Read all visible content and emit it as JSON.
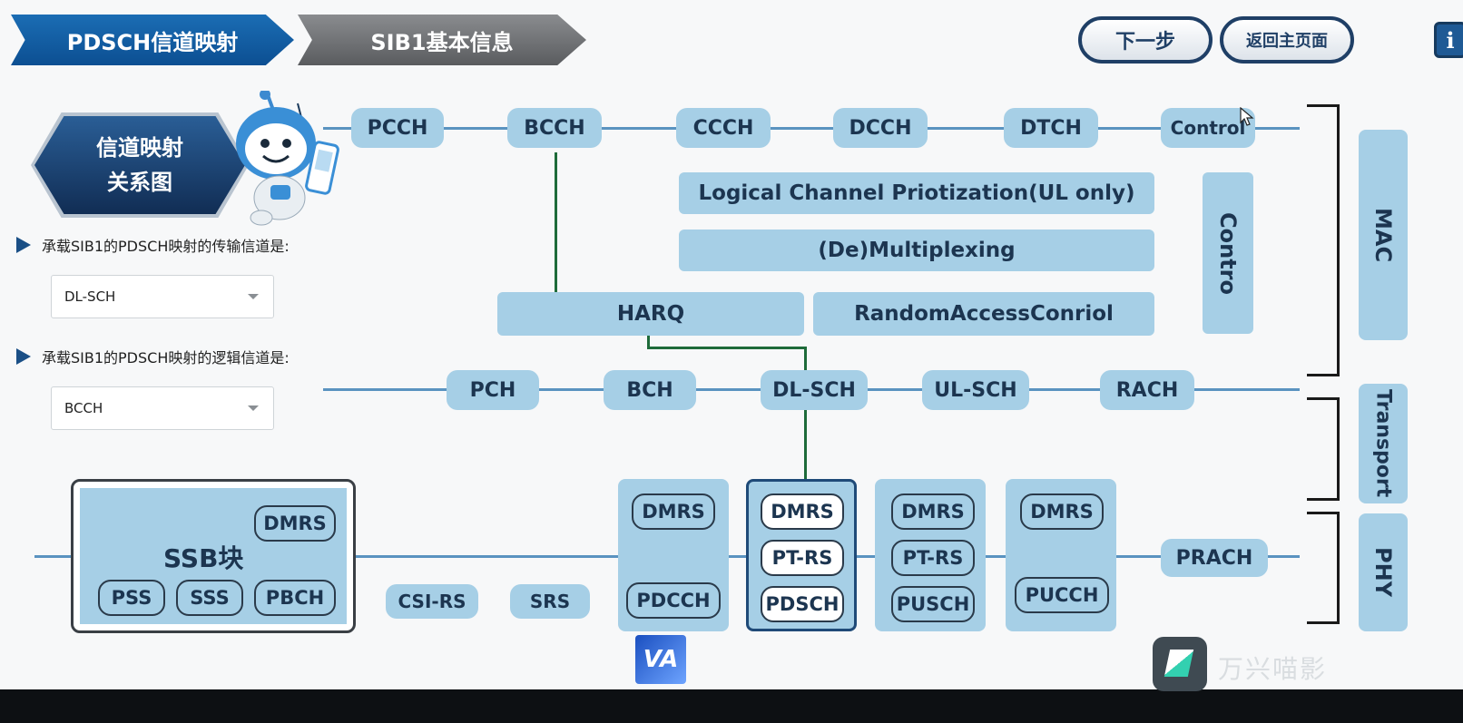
{
  "breadcrumb": {
    "active": "PDSCH信道映射",
    "next": "SIB1基本信息"
  },
  "top_buttons": {
    "next_step": "下一步",
    "home": "返回主页面",
    "info": "i"
  },
  "left_panel": {
    "title_line1": "信道映射",
    "title_line2": "关系图",
    "q1": "承载SIB1的PDSCH映射的传输信道是:",
    "q1_value": "DL-SCH",
    "q2": "承载SIB1的PDSCH映射的逻辑信道是:",
    "q2_value": "BCCH"
  },
  "logical_channels": [
    "PCCH",
    "BCCH",
    "CCCH",
    "DCCH",
    "DTCH",
    "Control"
  ],
  "mac_blocks": {
    "lcp": "Logical Channel Priotization(UL only)",
    "mux": "(De)Multiplexing",
    "harq": "HARQ",
    "rac": "RandomAccessConriol",
    "control": "Contro"
  },
  "transport_channels": [
    "PCH",
    "BCH",
    "DL-SCH",
    "UL-SCH",
    "RACH"
  ],
  "layers": {
    "mac": "MAC",
    "transport": "Transport",
    "phy": "PHY"
  },
  "phy": {
    "ssb_label": "SSB块",
    "ssb_dmrs": "DMRS",
    "pss": "PSS",
    "sss": "SSS",
    "pbch": "PBCH",
    "csi_rs": "CSI-RS",
    "srs": "SRS",
    "pdcch_dmrs": "DMRS",
    "pdcch": "PDCCH",
    "pdsch_dmrs": "DMRS",
    "pdsch_ptrs": "PT-RS",
    "pdsch": "PDSCH",
    "pusch_dmrs": "DMRS",
    "pusch_ptrs": "PT-RS",
    "pusch": "PUSCH",
    "pucch_dmrs": "DMRS",
    "pucch": "PUCCH",
    "prach": "PRACH"
  },
  "watermark": {
    "logo": "VA",
    "app": "万兴喵影"
  },
  "colors": {
    "accent_blue": "#0c4f92",
    "block_fill": "#a6cfe6",
    "mapping_line": "#1e6b3a"
  }
}
